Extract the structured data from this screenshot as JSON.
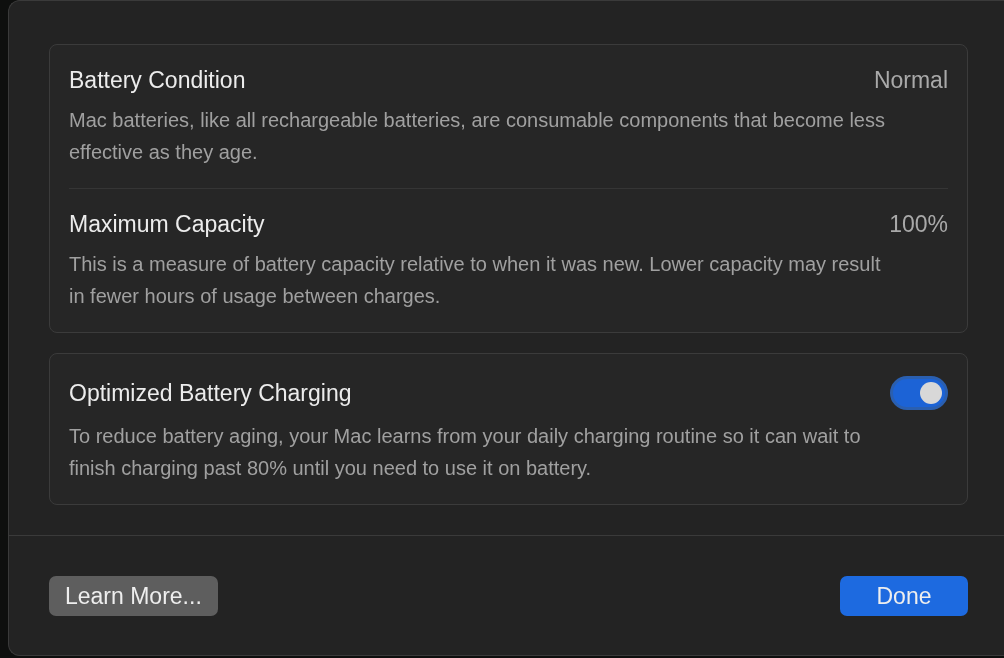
{
  "groups": [
    {
      "rows": [
        {
          "title": "Battery Condition",
          "value": "Normal",
          "description": "Mac batteries, like all rechargeable batteries, are consumable components that become less effective as they age.",
          "kind": "value"
        },
        {
          "title": "Maximum Capacity",
          "value": "100%",
          "description": "This is a measure of battery capacity relative to when it was new. Lower capacity may result in fewer hours of usage between charges.",
          "kind": "value"
        }
      ]
    },
    {
      "rows": [
        {
          "title": "Optimized Battery Charging",
          "on": true,
          "description": "To reduce battery aging, your Mac learns from your daily charging routine so it can wait to finish charging past 80% until you need to use it on battery.",
          "kind": "toggle"
        }
      ]
    }
  ],
  "buttons": [
    {
      "label": "Learn More...",
      "kind": "secondary"
    },
    {
      "label": "Done",
      "kind": "primary"
    }
  ]
}
